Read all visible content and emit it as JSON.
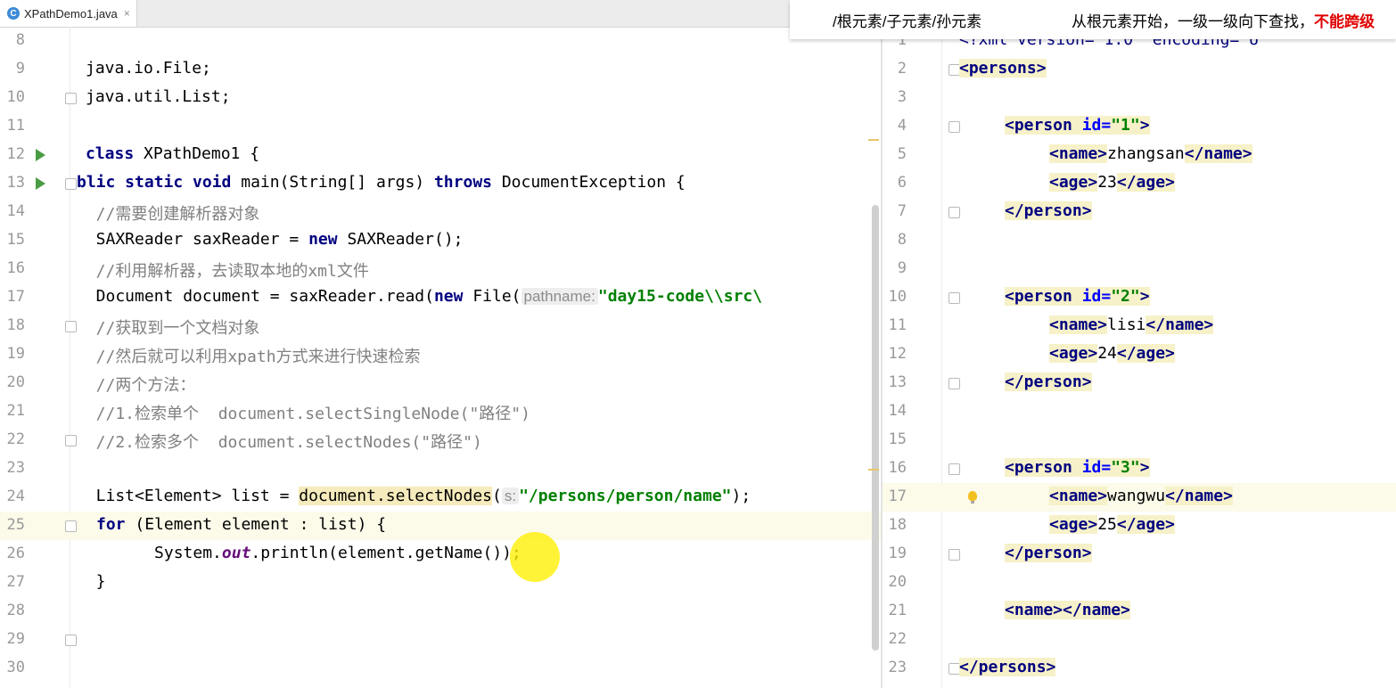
{
  "tab": {
    "title": "XPathDemo1.java",
    "close": "×",
    "icon": "C"
  },
  "tooltip": {
    "path": "/根元素/子元素/孙元素",
    "desc": "从根元素开始，一级一级向下查找，",
    "warn": "不能跨级"
  },
  "java": {
    "l8": "8",
    "l9": "9",
    "l10": "10",
    "l11": "11",
    "l12": "12",
    "l13": "13",
    "l14": "14",
    "l15": "15",
    "l16": "16",
    "l17": "17",
    "l18": "18",
    "l19": "19",
    "l20": "20",
    "l21": "21",
    "l22": "22",
    "l23": "23",
    "l24": "24",
    "l25": "25",
    "l26": "26",
    "l27": "27",
    "l28": "28",
    "l29": "29",
    "l30": "30",
    "c9": "java.io.File;",
    "c10": "java.util.List;",
    "c12a": "class",
    "c12b": " XPathDemo1 {",
    "c13a": "blic static void",
    "c13b": " main(String[] args) ",
    "c13c": "throws",
    "c13d": " DocumentException {",
    "c14": "  //需要创建解析器对象",
    "c15a": "  SAXReader saxReader = ",
    "c15b": "new",
    "c15c": " SAXReader();",
    "c16": "  //利用解析器，去读取本地的xml文件",
    "c17a": "  Document document = saxReader.read(",
    "c17b": "new",
    "c17c": " File(",
    "c17hint": "pathname:",
    "c17d": "\"day15-code\\\\src\\",
    "c18": "  //获取到一个文档对象",
    "c19": "  //然后就可以利用xpath方式来进行快速检索",
    "c20": "  //两个方法：",
    "c21": "  //1.检索单个  document.selectSingleNode(\"路径\")",
    "c22": "  //2.检索多个  document.selectNodes(\"路径\")",
    "c24a": "  List<Element> list = ",
    "c24b": "document.selectNodes",
    "c24c": "(",
    "c24hint": "s:",
    "c24d": "\"/persons/person/name\"",
    "c24e": ");",
    "c25a": "for",
    "c25b": " (Element element : list) {",
    "c26a": "      System.",
    "c26b": "out",
    "c26c": ".println(element.getName());",
    "c27": "  }"
  },
  "xml": {
    "n1": "1",
    "n2": "2",
    "n3": "3",
    "n4": "4",
    "n5": "5",
    "n6": "6",
    "n7": "7",
    "n8": "8",
    "n9": "9",
    "n10": "10",
    "n11": "11",
    "n12": "12",
    "n13": "13",
    "n14": "14",
    "n15": "15",
    "n16": "16",
    "n17": "17",
    "n18": "18",
    "n19": "19",
    "n20": "20",
    "n21": "21",
    "n22": "22",
    "n23": "23",
    "x1": "<?xml version=\"1.0\" encoding=\"U",
    "persons_open": "<persons>",
    "persons_close": "</persons>",
    "person_tag": "<person",
    "id_attr": " id=",
    "id1": "\"1\"",
    "id2": "\"2\"",
    "id3": "\"3\"",
    "gt": ">",
    "person_close": "</person>",
    "name_open": "<name>",
    "name_close": "</name>",
    "age_open": "<age>",
    "age_close": "</age>",
    "zhangsan": "zhangsan",
    "lisi": "lisi",
    "wangwu": "wangwu",
    "a23": "23",
    "a24": "24",
    "a25": "25",
    "empty_name": "<name></name>"
  }
}
